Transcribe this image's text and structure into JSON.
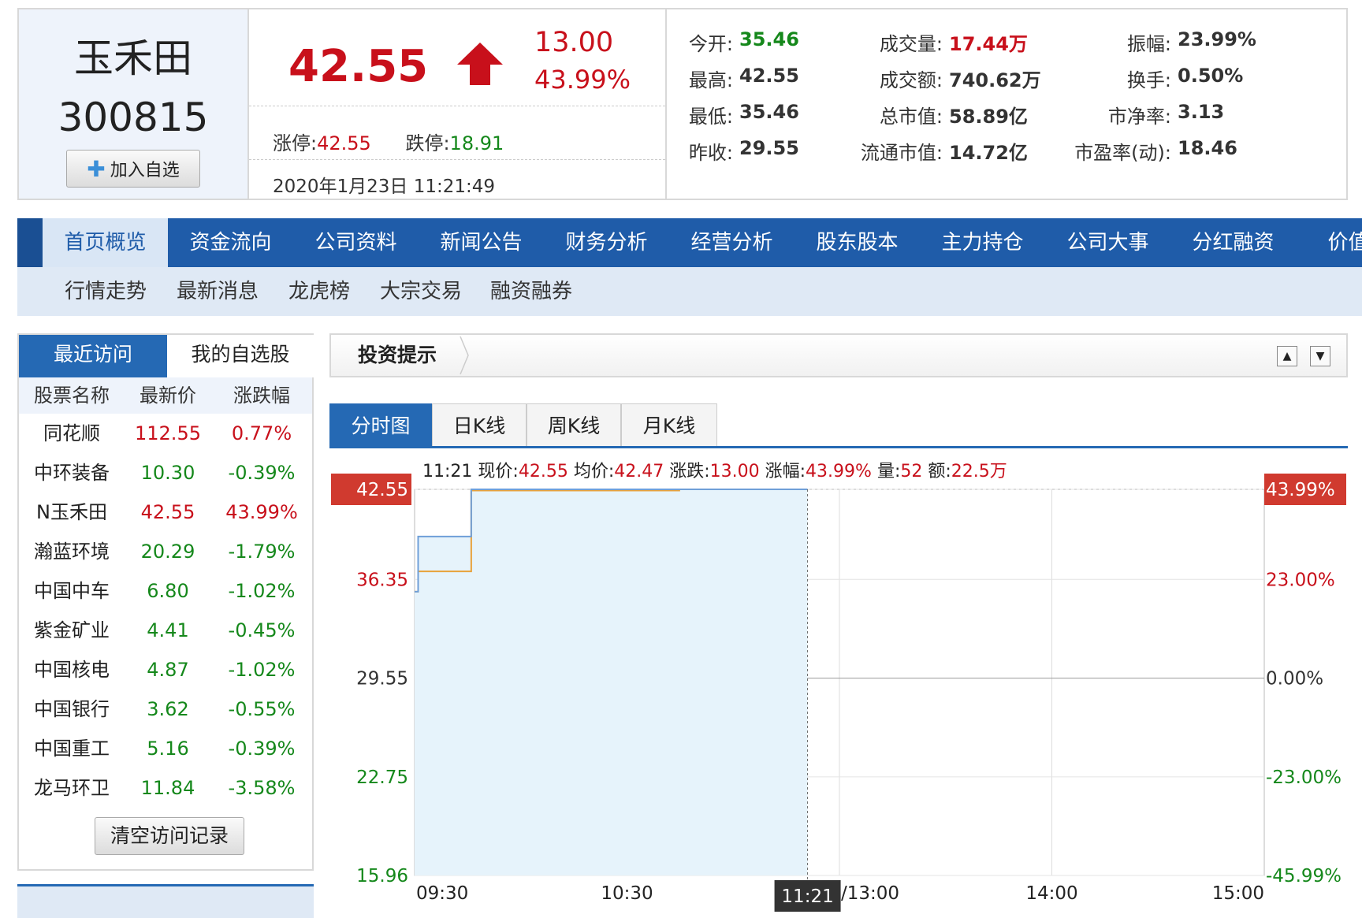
{
  "header": {
    "name": "玉禾田",
    "code": "300815",
    "add_button": "加入自选",
    "price": "42.55",
    "change": "13.00",
    "change_pct": "43.99%",
    "limit_up_label": "涨停:",
    "limit_up": "42.55",
    "limit_down_label": "跌停:",
    "limit_down": "18.91",
    "timestamp": "2020年1月23日 11:21:49",
    "stats": [
      {
        "label": "今开:",
        "value": "35.46",
        "color": "green"
      },
      {
        "label": "最高:",
        "value": "42.55",
        "color": "normal"
      },
      {
        "label": "最低:",
        "value": "35.46",
        "color": "normal"
      },
      {
        "label": "昨收:",
        "value": "29.55",
        "color": "normal"
      },
      {
        "label": "成交量:",
        "value": "17.44万",
        "color": "red"
      },
      {
        "label": "成交额:",
        "value": "740.62万",
        "color": "normal"
      },
      {
        "label": "总市值:",
        "value": "58.89亿",
        "color": "normal"
      },
      {
        "label": "流通市值:",
        "value": "14.72亿",
        "color": "normal"
      },
      {
        "label": "振幅:",
        "value": "23.99%",
        "color": "normal"
      },
      {
        "label": "换手:",
        "value": "0.50%",
        "color": "normal"
      },
      {
        "label": "市净率:",
        "value": "3.13",
        "color": "normal"
      },
      {
        "label": "市盈率(动):",
        "value": "18.46",
        "color": "normal"
      }
    ]
  },
  "nav": {
    "items": [
      "首页概览",
      "资金流向",
      "公司资料",
      "新闻公告",
      "财务分析",
      "经营分析",
      "股东股本",
      "主力持仓",
      "公司大事",
      "分红融资",
      "价值分"
    ],
    "active_index": 0,
    "sub_items": [
      "行情走势",
      "最新消息",
      "龙虎榜",
      "大宗交易",
      "融资融券"
    ]
  },
  "left_panel": {
    "tabs": [
      "最近访问",
      "我的自选股"
    ],
    "headers": [
      "股票名称",
      "最新价",
      "涨跌幅"
    ],
    "rows": [
      {
        "name": "同花顺",
        "price": "112.55",
        "pct": "0.77%",
        "dir": "up"
      },
      {
        "name": "中环装备",
        "price": "10.30",
        "pct": "-0.39%",
        "dir": "down"
      },
      {
        "name": "N玉禾田",
        "price": "42.55",
        "pct": "43.99%",
        "dir": "up"
      },
      {
        "name": "瀚蓝环境",
        "price": "20.29",
        "pct": "-1.79%",
        "dir": "down"
      },
      {
        "name": "中国中车",
        "price": "6.80",
        "pct": "-1.02%",
        "dir": "down"
      },
      {
        "name": "紫金矿业",
        "price": "4.41",
        "pct": "-0.45%",
        "dir": "down"
      },
      {
        "name": "中国核电",
        "price": "4.87",
        "pct": "-1.02%",
        "dir": "down"
      },
      {
        "name": "中国银行",
        "price": "3.62",
        "pct": "-0.55%",
        "dir": "down"
      },
      {
        "name": "中国重工",
        "price": "5.16",
        "pct": "-0.39%",
        "dir": "down"
      },
      {
        "name": "龙马环卫",
        "price": "11.84",
        "pct": "-3.58%",
        "dir": "down"
      }
    ],
    "clear_button": "清空访问记录"
  },
  "tips": {
    "title": "投资提示"
  },
  "chart_tabs": [
    "分时图",
    "日K线",
    "周K线",
    "月K线"
  ],
  "chart_tabs_active": 0,
  "chart_data": {
    "type": "line",
    "info": {
      "time": "11:21",
      "price_label": "现价:",
      "price": "42.55",
      "avg_label": "均价:",
      "avg": "42.47",
      "chg_label": "涨跌:",
      "chg": "13.00",
      "pct_label": "涨幅:",
      "pct": "43.99%",
      "vol_label": "量:",
      "vol": "52",
      "amt_label": "额:",
      "amt": "22.5万"
    },
    "y_labels_left": [
      "42.55",
      "36.35",
      "29.55",
      "22.75",
      "15.96"
    ],
    "y_values": [
      42.55,
      36.35,
      29.55,
      22.75,
      15.96
    ],
    "y_labels_right": [
      "43.99%",
      "23.00%",
      "0.00%",
      "-23.00%",
      "-45.99%"
    ],
    "x_labels": [
      "09:30",
      "10:30",
      "11:21",
      "/13:00",
      "14:00",
      "15:00"
    ],
    "ylim": [
      15.96,
      42.55
    ],
    "prev_close": 29.55,
    "price_series": {
      "name": "现价",
      "color": "#6f9fd8",
      "points": [
        [
          "09:30",
          35.5
        ],
        [
          "09:31",
          39.3
        ],
        [
          "09:45",
          39.3
        ],
        [
          "09:46",
          42.55
        ],
        [
          "11:21",
          42.55
        ]
      ]
    },
    "avg_series": {
      "name": "均价",
      "color": "#e8a23b",
      "points": [
        [
          "09:30",
          35.5
        ],
        [
          "09:31",
          36.9
        ],
        [
          "09:45",
          36.9
        ],
        [
          "09:46",
          42.47
        ],
        [
          "10:45",
          42.47
        ]
      ]
    },
    "crosshair_time": "11:21"
  }
}
